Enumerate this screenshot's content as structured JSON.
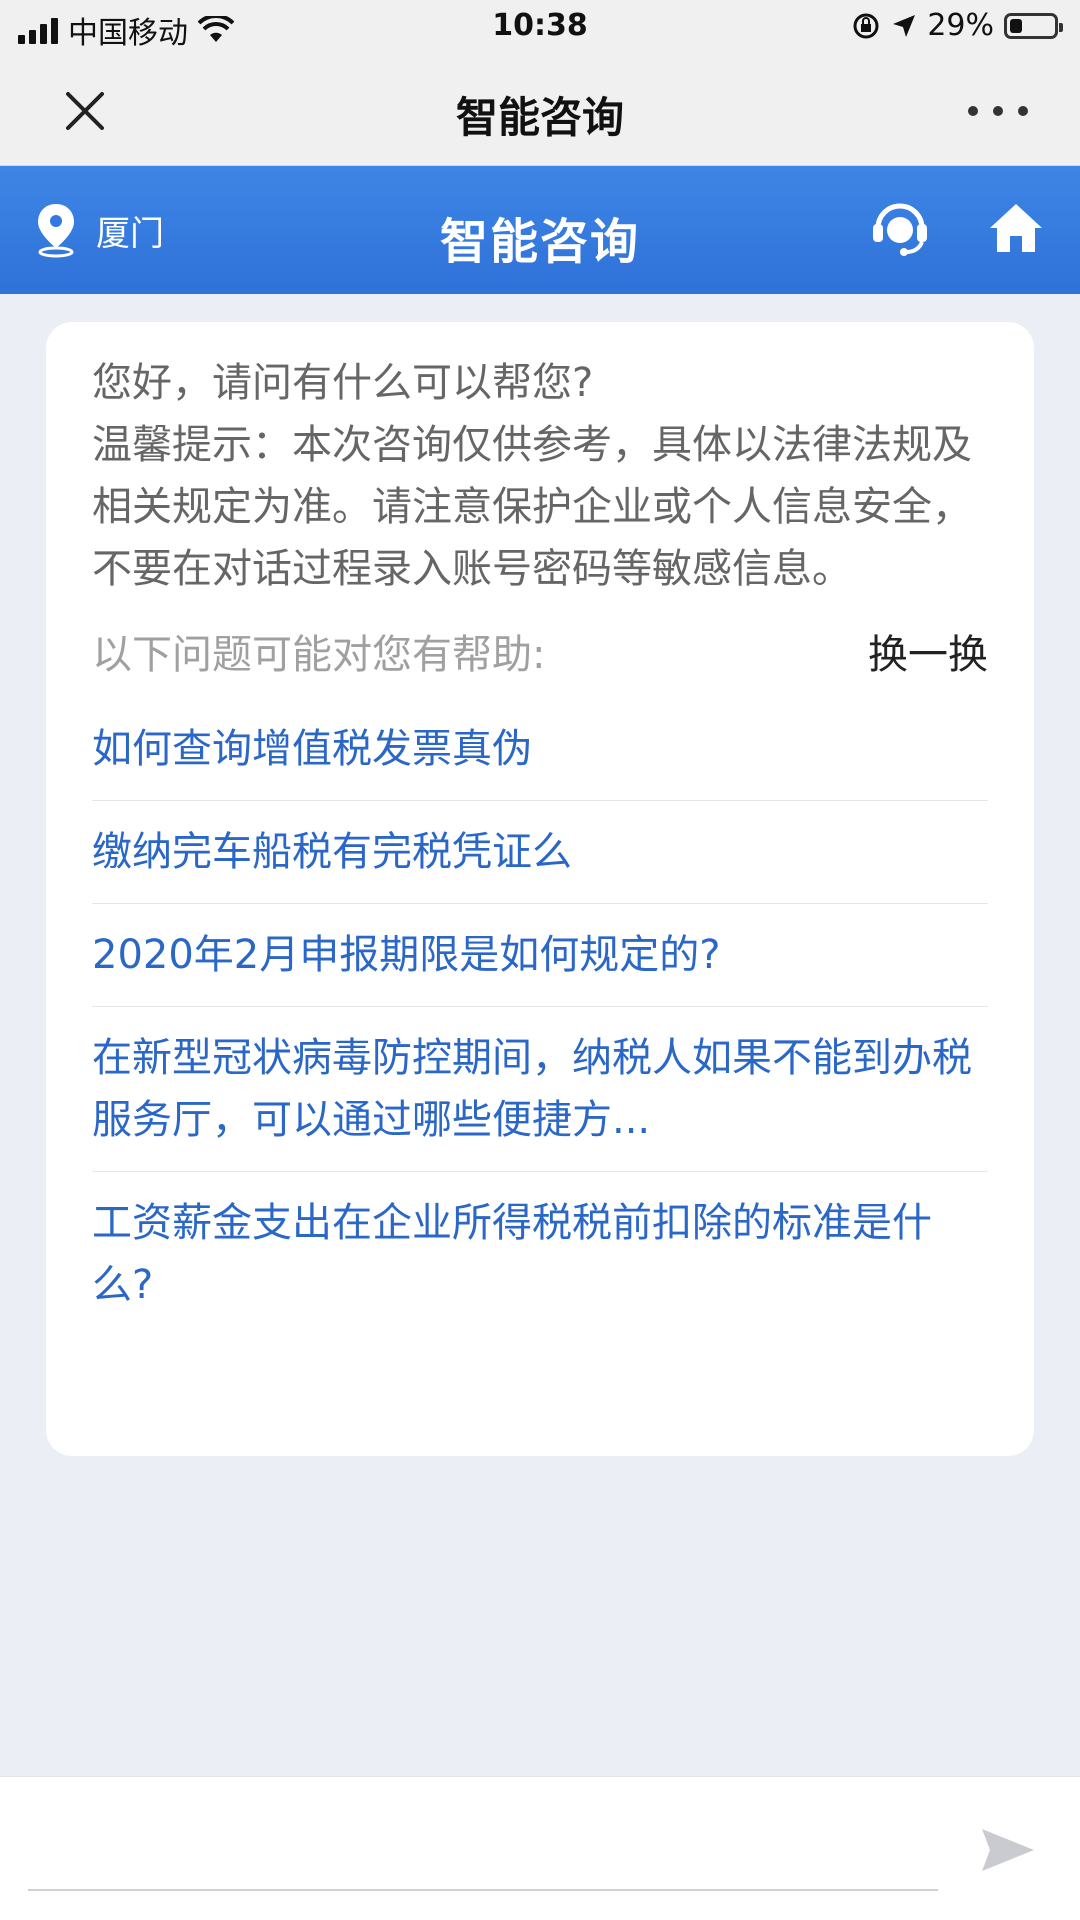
{
  "status_bar": {
    "carrier": "中国移动",
    "time": "10:38",
    "battery": "29%",
    "battery_level": 0.29
  },
  "nav_bar": {
    "title": "智能咨询",
    "close_icon": "close-icon",
    "more_icon": "more-icon"
  },
  "header": {
    "location": "厦门",
    "title": "智能咨询",
    "location_icon": "location-pin-icon",
    "service_icon": "customer-service-icon",
    "home_icon": "home-icon",
    "color": "#3478df"
  },
  "card": {
    "greeting": "您好，请问有什么可以帮您?",
    "tips": "温馨提示：本次咨询仅供参考，具体以法律法规及相关规定为准。请注意保护企业或个人信息安全，不要在对话过程录入账号密码等敏感信息。",
    "help_label": "以下问题可能对您有帮助:",
    "refresh_label": "换一换",
    "questions": [
      "如何查询增值税发票真伪",
      "缴纳完车船税有完税凭证么",
      "2020年2月申报期限是如何规定的?",
      "在新型冠状病毒防控期间，纳税人如果不能到办税服务厅，可以通过哪些便捷方...",
      "工资薪金支出在企业所得税税前扣除的标准是什么?"
    ],
    "link_color": "#2a67c7"
  },
  "input": {
    "placeholder": "",
    "send_icon": "send-icon"
  }
}
